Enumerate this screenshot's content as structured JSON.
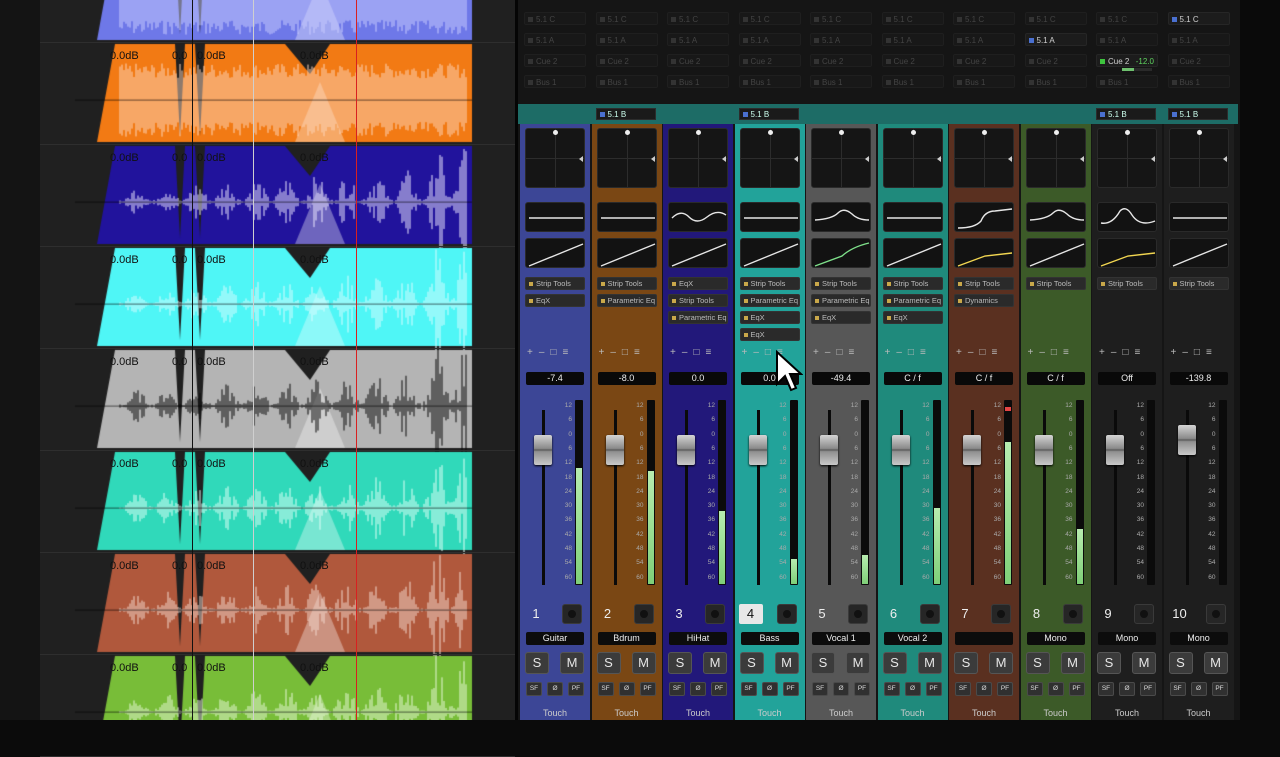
{
  "arrange": {
    "tracks": [
      {
        "color": "#6e78e8",
        "wave": "#c9ccff",
        "labels": []
      },
      {
        "color": "#f27a14",
        "wave": "#fdd4b8",
        "labels": [
          "0.0dB",
          "0.0",
          "0.0dB",
          "0.0dB"
        ]
      },
      {
        "color": "#21139c",
        "wave": "#ece8ff",
        "labels": [
          "0.0dB",
          "0.0",
          "0.0dB",
          "0.0dB"
        ]
      },
      {
        "color": "#4ff6f6",
        "wave": "#d8fdff",
        "labels": [
          "0.0dB",
          "0.0",
          "0.0dB",
          "0.0dB"
        ]
      },
      {
        "color": "#b4b4b4",
        "wave": "#0a0a0a",
        "labels": [
          "0.0dB",
          "0.0",
          "0.0dB",
          "0.0dB"
        ]
      },
      {
        "color": "#30d9ba",
        "wave": "#dffff6",
        "labels": [
          "0.0dB",
          "0.0",
          "0.0dB",
          "0.0dB"
        ]
      },
      {
        "color": "#b0583c",
        "wave": "#f3d8cd",
        "labels": [
          "0.0dB",
          "0.0",
          "0.0dB",
          "0.0dB"
        ]
      },
      {
        "color": "#78bd38",
        "wave": "#e6f8d6",
        "labels": [
          "0.0dB",
          "0.0",
          "0.0dB",
          "0.0dB"
        ]
      }
    ]
  },
  "colors": {
    "playhead": "#d92020",
    "teal_io": "#1d6c66"
  },
  "mixer": {
    "channels": [
      {
        "number": "1",
        "name": "Guitar",
        "volume": "-7.4",
        "tint": "#3c4696",
        "sends": [
          {
            "label": "5.1 C",
            "ghost": true
          },
          {
            "label": "5.1 A",
            "ghost": true
          },
          {
            "label": "Cue 2",
            "ghost": true
          },
          {
            "label": "Bus 1",
            "ghost": true
          }
        ],
        "io": "",
        "eq": "flat",
        "dyn": "line",
        "inserts": [
          "Strip Tools",
          "EqX"
        ],
        "fader_level": 0.83,
        "meter_level": 0.64,
        "meter_peak": null,
        "selected": false
      },
      {
        "number": "2",
        "name": "Bdrum",
        "volume": "-8.0",
        "tint": "#7a4714",
        "sends": [
          {
            "label": "5.1 C",
            "ghost": true
          },
          {
            "label": "5.1 A",
            "ghost": true
          },
          {
            "label": "Cue 2",
            "ghost": true
          },
          {
            "label": "Bus 1",
            "ghost": true
          }
        ],
        "io": "5.1 B",
        "eq": "flat",
        "dyn": "line",
        "inserts": [
          "Strip Tools",
          "Parametric Eq"
        ],
        "fader_level": 0.83,
        "meter_level": 0.62,
        "meter_peak": null,
        "selected": false
      },
      {
        "number": "3",
        "name": "HiHat",
        "volume": "0.0",
        "tint": "#22187a",
        "sends": [
          {
            "label": "5.1 C",
            "ghost": true
          },
          {
            "label": "5.1 A",
            "ghost": true
          },
          {
            "label": "Cue 2",
            "ghost": true
          },
          {
            "label": "Bus 1",
            "ghost": true
          }
        ],
        "io": "",
        "eq": "wave",
        "dyn": "line",
        "inserts": [
          "EqX",
          "Strip Tools",
          "Parametric Eq"
        ],
        "fader_level": 0.83,
        "meter_level": 0.4,
        "meter_peak": null,
        "selected": false
      },
      {
        "number": "4",
        "name": "Bass",
        "volume": "0.0",
        "tint": "#22a39a",
        "sends": [
          {
            "label": "5.1 C",
            "ghost": true
          },
          {
            "label": "5.1 A",
            "ghost": true
          },
          {
            "label": "Cue 2",
            "ghost": true
          },
          {
            "label": "Bus 1",
            "ghost": true
          }
        ],
        "io": "5.1 B",
        "eq": "flat",
        "dyn": "line",
        "inserts": [
          "Strip Tools",
          "Parametric Eq",
          "EqX",
          "EqX"
        ],
        "fader_level": 0.83,
        "meter_level": 0.14,
        "meter_peak": null,
        "selected": true
      },
      {
        "number": "5",
        "name": "Vocal 1",
        "volume": "-49.4",
        "tint": "#575757",
        "sends": [
          {
            "label": "5.1 C",
            "ghost": true
          },
          {
            "label": "5.1 A",
            "ghost": true
          },
          {
            "label": "Cue 2",
            "ghost": true
          },
          {
            "label": "Bus 1",
            "ghost": true
          }
        ],
        "io": "",
        "eq": "bump",
        "dyn": "green",
        "inserts": [
          "Strip Tools",
          "Parametric Eq",
          "EqX"
        ],
        "fader_level": 0.83,
        "meter_level": 0.16,
        "meter_peak": null,
        "selected": false
      },
      {
        "number": "6",
        "name": "Vocal 2",
        "volume": "C / f",
        "tint": "#1f8a7c",
        "sends": [
          {
            "label": "5.1 C",
            "ghost": true
          },
          {
            "label": "5.1 A",
            "ghost": true
          },
          {
            "label": "Cue 2",
            "ghost": true
          },
          {
            "label": "Bus 1",
            "ghost": true
          }
        ],
        "io": "",
        "eq": "flat",
        "dyn": "line",
        "inserts": [
          "Strip Tools",
          "Parametric Eq",
          "EqX"
        ],
        "fader_level": 0.83,
        "meter_level": 0.42,
        "meter_peak": null,
        "selected": false
      },
      {
        "number": "7",
        "name": "",
        "volume": "C / f",
        "tint": "#5a3020",
        "sends": [
          {
            "label": "5.1 C",
            "ghost": true
          },
          {
            "label": "5.1 A",
            "ghost": true
          },
          {
            "label": "Cue 2",
            "ghost": true
          },
          {
            "label": "Bus 1",
            "ghost": true
          }
        ],
        "io": "",
        "eq": "shelf",
        "dyn": "yellow",
        "inserts": [
          "Strip Tools",
          "Dynamics"
        ],
        "fader_level": 0.83,
        "meter_level": 0.78,
        "meter_peak": 0.96,
        "selected": false
      },
      {
        "number": "8",
        "name": "Mono",
        "volume": "C / f",
        "tint": "#3c5a28",
        "sends": [
          {
            "label": "5.1 C",
            "ghost": true
          },
          {
            "label": "5.1 A",
            "ghost": false
          },
          {
            "label": "Cue 2",
            "ghost": true
          },
          {
            "label": "Bus 1",
            "ghost": true
          }
        ],
        "io": "",
        "eq": "bump",
        "dyn": "line",
        "inserts": [
          "Strip Tools"
        ],
        "fader_level": 0.83,
        "meter_level": 0.3,
        "meter_peak": null,
        "selected": false
      },
      {
        "number": "9",
        "name": "Mono",
        "volume": "Off",
        "tint": "#1e1e1e",
        "sends": [
          {
            "label": "5.1 C",
            "ghost": true
          },
          {
            "label": "5.1 A",
            "ghost": true
          },
          {
            "label": "Cue 2",
            "ghost": false,
            "value": "-12.0"
          },
          {
            "label": "Bus 1",
            "ghost": true
          }
        ],
        "io": "5.1 B",
        "eq": "peak",
        "dyn": "yellow",
        "inserts": [
          "Strip Tools"
        ],
        "fader_level": 0.83,
        "meter_level": 0.0,
        "meter_peak": null,
        "selected": false
      },
      {
        "number": "10",
        "name": "Mono",
        "volume": "-139.8",
        "tint": "#1e1e1e",
        "sends": [
          {
            "label": "5.1 C",
            "ghost": false
          },
          {
            "label": "5.1 A",
            "ghost": true
          },
          {
            "label": "Cue 2",
            "ghost": true
          },
          {
            "label": "Bus 1",
            "ghost": true
          }
        ],
        "io": "5.1 B",
        "eq": "flat",
        "dyn": "line",
        "inserts": [
          "Strip Tools"
        ],
        "fader_level": 0.9,
        "meter_level": 0.0,
        "meter_peak": null,
        "selected": false
      }
    ],
    "scale_labels": [
      "12",
      "6",
      "0",
      "6",
      "12",
      "18",
      "24",
      "30",
      "36",
      "42",
      "48",
      "54",
      "60"
    ],
    "insert_controls": [
      "+",
      "–",
      "□",
      "≡"
    ],
    "solo_label": "S",
    "mute_label": "M",
    "sf_label": "SF",
    "phase_label": "Ø",
    "pf_label": "PF",
    "automation_label": "Touch"
  }
}
